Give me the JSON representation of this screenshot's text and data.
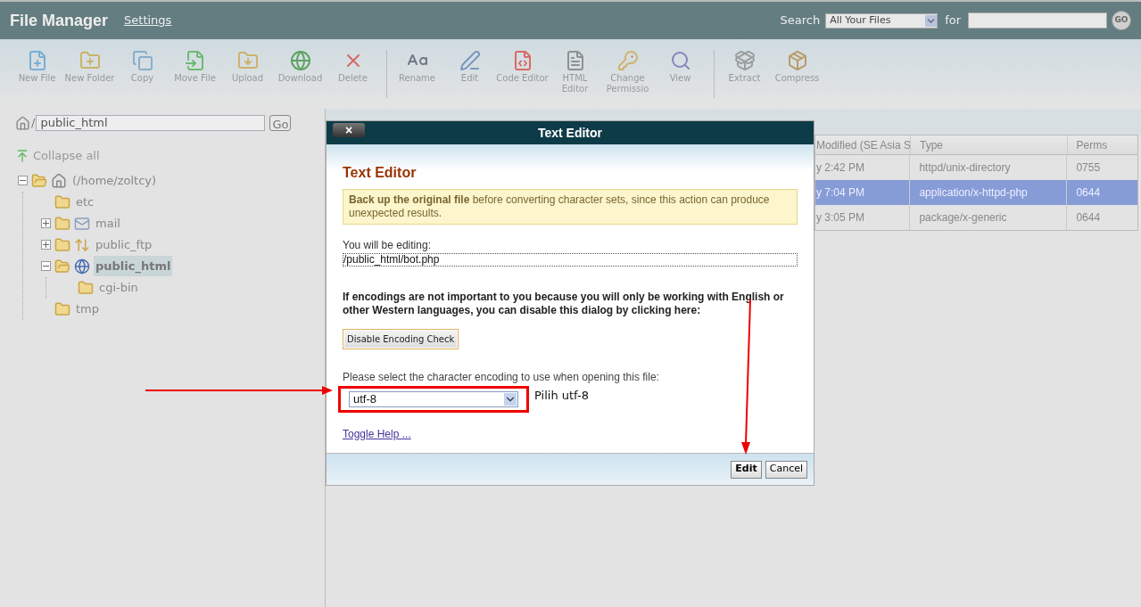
{
  "header": {
    "title": "File Manager",
    "settings_link": "Settings",
    "search_label": "Search",
    "search_scope": "All Your Files",
    "for_label": "for",
    "go_button": "GO"
  },
  "toolbar": {
    "groups": [
      [
        {
          "kind": "new-file",
          "label": "New File"
        },
        {
          "kind": "new-folder",
          "label": "New Folder"
        },
        {
          "kind": "copy",
          "label": "Copy"
        },
        {
          "kind": "move",
          "label": "Move File"
        },
        {
          "kind": "upload",
          "label": "Upload"
        },
        {
          "kind": "download",
          "label": "Download"
        },
        {
          "kind": "delete",
          "label": "Delete"
        }
      ],
      [
        {
          "kind": "rename",
          "label": "Rename"
        },
        {
          "kind": "edit",
          "label": "Edit"
        },
        {
          "kind": "code",
          "label": "Code Editor"
        },
        {
          "kind": "html",
          "label": "HTML Editor"
        },
        {
          "kind": "permissions",
          "label": "Change Permissio"
        },
        {
          "kind": "view",
          "label": "View"
        }
      ],
      [
        {
          "kind": "extract",
          "label": "Extract"
        },
        {
          "kind": "compress",
          "label": "Compress"
        }
      ]
    ]
  },
  "path_bar": {
    "separator": "/",
    "value": "public_html",
    "go_button": "Go"
  },
  "collapse_all": "Collapse all",
  "tree": [
    {
      "label": "(/home/zoltcy)",
      "kind": "home",
      "expanded": true,
      "selected": false,
      "children": [
        {
          "label": "etc",
          "kind": "folder",
          "selected": false
        },
        {
          "label": "mail",
          "kind": "mail",
          "expanded": false,
          "selected": false
        },
        {
          "label": "public_ftp",
          "kind": "ftp",
          "expanded": false,
          "selected": false
        },
        {
          "label": "public_html",
          "kind": "web",
          "expanded": true,
          "selected": true,
          "children": [
            {
              "label": "cgi-bin",
              "kind": "folder",
              "selected": false
            }
          ]
        },
        {
          "label": "tmp",
          "kind": "folder",
          "selected": false
        }
      ]
    }
  ],
  "file_table": {
    "columns": [
      "Modified (SE Asia S",
      "Type",
      "Perms"
    ],
    "rows": [
      {
        "cells": [
          "y 2:42 PM",
          "httpd/unix-directory",
          "0755"
        ],
        "selected": false
      },
      {
        "cells": [
          "y 7:04 PM",
          "application/x-httpd-php",
          "0644"
        ],
        "selected": true
      },
      {
        "cells": [
          "y 3:05 PM",
          "package/x-generic",
          "0644"
        ],
        "selected": false
      }
    ]
  },
  "dialog": {
    "title": "Text Editor",
    "close_button": "×",
    "heading": "Text Editor",
    "warning": "**Back up the original file** before converting character sets, since this action can produce unexpected results.",
    "editing_label": "You will be editing:",
    "editing_path": "/public_html/bot.php",
    "encoding_note": "If encodings are not important to you because you will only be working with English or other Western languages, you can disable this dialog by clicking here:",
    "disable_button": "Disable Encoding Check",
    "select_label": "Please select the character encoding to use when opening this file:",
    "encoding": "utf-8",
    "toggle_help": "Toggle Help ...",
    "edit_button": "Edit",
    "cancel_button": "Cancel"
  },
  "annotation": {
    "note": "Pilih utf-8"
  }
}
